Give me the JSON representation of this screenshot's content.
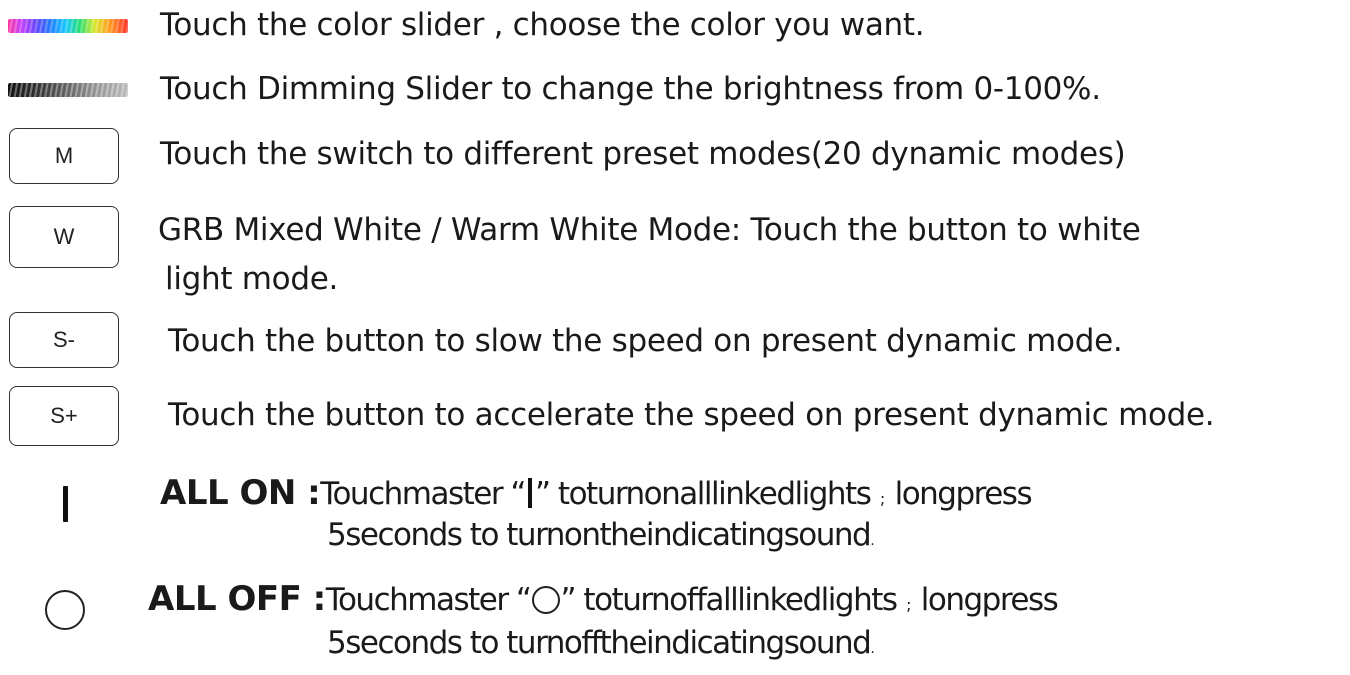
{
  "rows": {
    "color_slider": {
      "icon": "color-slider-icon",
      "text": "Touch the color slider , choose the color you want."
    },
    "dimming_slider": {
      "icon": "dimming-slider-icon",
      "text": "Touch Dimming Slider to change the brightness from 0-100%."
    },
    "mode": {
      "button_label": "M",
      "text": "Touch the switch to different preset modes(20 dynamic modes)"
    },
    "white": {
      "button_label": "W",
      "text_line1": "GRB Mixed White / Warm White Mode: Touch the button to white",
      "text_line2": "light mode."
    },
    "speed_down": {
      "button_label": "S-",
      "text": "Touch the button to slow the speed on present dynamic mode."
    },
    "speed_up": {
      "button_label": "S+",
      "text": "Touch the button to accelerate the speed on present dynamic mode."
    },
    "all_on": {
      "icon": "power-on-bar-icon",
      "label": "ALL ON :",
      "text_prefix": "Touchmaster “",
      "text_suffix": "” toturnonalllinkedlights",
      "separator": ";",
      "text_end": "longpress",
      "line2": "5seconds to turnontheindicatingsound",
      "line2_end": "."
    },
    "all_off": {
      "icon": "power-off-circle-icon",
      "label": "ALL OFF :",
      "text_prefix": "Touchmaster “",
      "text_suffix": "” toturnoffalllinkedlights",
      "separator": ";",
      "text_end": "longpress",
      "line2": "5seconds to turnofftheindicatingsound",
      "line2_end": "."
    }
  },
  "colors": {
    "text": "#1a1a1a",
    "button_border": "#333333"
  }
}
